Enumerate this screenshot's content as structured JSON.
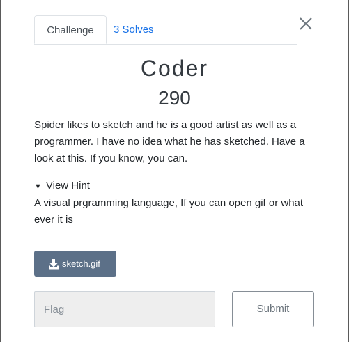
{
  "tabs": [
    {
      "label": "Challenge",
      "active": true
    },
    {
      "label": "3 Solves",
      "active": false
    }
  ],
  "challenge": {
    "name": "Coder",
    "value": "290",
    "description": "Spider likes to sketch and he is a good artist as well as a programmer. I have no idea what he has sketched. Have a look at this. If you know, you can.",
    "hint": {
      "summary": "View Hint",
      "content": "A visual prgramming language, If you can open gif or what ever it is"
    },
    "file": {
      "label": "sketch.gif",
      "icon": "download-icon"
    }
  },
  "form": {
    "flag_placeholder": "Flag",
    "submit_label": "Submit"
  },
  "colors": {
    "tab_link": "#1a73e8",
    "file_button": "#5c7088",
    "text": "#212529"
  }
}
